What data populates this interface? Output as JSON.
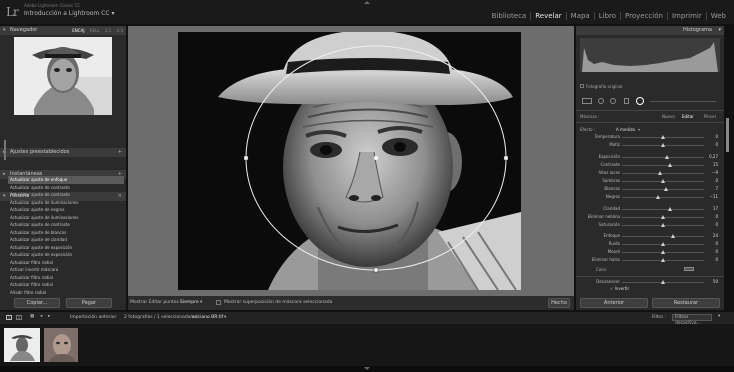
{
  "app": {
    "logo": "Lr",
    "subtitle": "Adobe Lightroom Classic CC",
    "catalog": "Introducción a Lightroom CC",
    "modules": [
      "Biblioteca",
      "Revelar",
      "Mapa",
      "Libro",
      "Proyección",
      "Imprimir",
      "Web"
    ],
    "active_module": "Revelar"
  },
  "left": {
    "navigator": {
      "title": "Navegador",
      "opts": [
        "ENCAJ",
        "RELL",
        "1:1",
        "1:3"
      ],
      "selected_opt": "ENCAJ"
    },
    "presets": "Ajustes preestablecidos",
    "snapshots": "Instantáneas",
    "history": {
      "title": "Historia",
      "items": [
        "Actualizar ajuste de enfoque",
        "Actualizar ajuste de contraste",
        "Actualizar ajuste de contraste",
        "Actualizar ajuste de iluminaciones",
        "Actualizar ajuste de negros",
        "Actualizar ajuste de iluminaciones",
        "Actualizar ajuste de contraste",
        "Actualizar ajuste de blancos",
        "Actualizar ajuste de claridad",
        "Actualizar ajuste de exposición",
        "Actualizar ajuste de exposición",
        "Actualizar filtro radial",
        "Activar invertir máscara",
        "Actualizar filtro radial",
        "Actualizar filtro radial",
        "Añadir filtro radial"
      ]
    },
    "copy_btn": "Copiar...",
    "paste_btn": "Pegar"
  },
  "toolbar": {
    "show_pins_label": "Mostrar Editar puntos :",
    "show_pins_value": "Siempre",
    "overlay_label": "Mostrar superposición de máscara seleccionada",
    "done_btn": "Hecho"
  },
  "right": {
    "histogram_title": "Histograma",
    "original_photo": "Fotografía original",
    "mask_label": "Máscara :",
    "mask_new": "Nuevo",
    "mask_edit": "Editar",
    "mask_brush": "Pincel",
    "effect_label": "Efecto :",
    "effect_value": "A medida",
    "sliders": [
      {
        "label": "Temperatura",
        "val": "0",
        "pos": 0.5
      },
      {
        "label": "Matiz",
        "val": "0",
        "pos": 0.5
      },
      {
        "label": "Exposición",
        "val": "0,27",
        "pos": 0.55
      },
      {
        "label": "Contraste",
        "val": "15",
        "pos": 0.58
      },
      {
        "label": "Altas luces",
        "val": "−9",
        "pos": 0.46
      },
      {
        "label": "Sombras",
        "val": "0",
        "pos": 0.5
      },
      {
        "label": "Blancos",
        "val": "7",
        "pos": 0.54
      },
      {
        "label": "Negros",
        "val": "−11",
        "pos": 0.44
      },
      {
        "label": "Claridad",
        "val": "17",
        "pos": 0.59
      },
      {
        "label": "Eliminar neblina",
        "val": "0",
        "pos": 0.5
      },
      {
        "label": "Saturación",
        "val": "0",
        "pos": 0.5
      },
      {
        "label": "Enfoque",
        "val": "24",
        "pos": 0.62
      },
      {
        "label": "Ruido",
        "val": "0",
        "pos": 0.5
      },
      {
        "label": "Moaré",
        "val": "0",
        "pos": 0.5
      },
      {
        "label": "Eliminar halos",
        "val": "0",
        "pos": 0.5
      }
    ],
    "color_label": "Color",
    "feather_label": "Desvanecer",
    "feather_value": "50",
    "feather_pos": 0.5,
    "invert_label": "Invertir",
    "prev_btn": "Anterior",
    "reset_btn": "Restaurar"
  },
  "filmstrip": {
    "page1": "1",
    "page2": "2",
    "source": "Importación anterior",
    "info": "2 fotografías / 1 seleccionada/s /",
    "filename": "anciano BR.tif",
    "filter_label": "Filtro :",
    "filter_value": "Filtros desactiva..."
  },
  "colors": {
    "active_module": "#e8e8e8",
    "panel": "#2a2a2a",
    "header": "#3b3b3b",
    "canvas": "#6d6d6d"
  }
}
